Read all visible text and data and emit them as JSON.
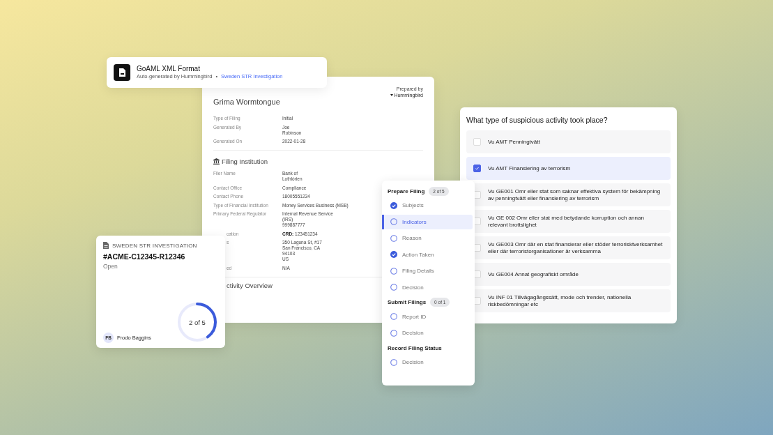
{
  "goaml_card": {
    "title": "GoAML XML Format",
    "subtitle": "Auto-generated by Hummingbird",
    "separator": "•",
    "link": "Sweden STR Investigation"
  },
  "document": {
    "prepared_by": "Prepared by",
    "brand": "Hummingbird",
    "name": "Grima Wormtongue",
    "summary": [
      {
        "label": "Type of Filing",
        "value": "Initial"
      },
      {
        "label": "Generated By",
        "value": "Joe\nRobinson"
      },
      {
        "label": "Generated On",
        "value": "2022-01-28"
      }
    ],
    "section_title": "Filing Institution",
    "fields": [
      {
        "kind": "plain",
        "label": "Filer Name",
        "value": "Bank of\nLothlórien"
      },
      {
        "kind": "plain",
        "label": "Contact Office",
        "value": "Compliance"
      },
      {
        "kind": "plain",
        "label": "Contact Phone",
        "value": "18005551234"
      },
      {
        "kind": "plain",
        "label": "Type of Financial Institution",
        "value": "Money Services Business (MSB)"
      },
      {
        "kind": "plain",
        "label": "Primary Federal Regulator",
        "value": "Internal Revenue Service\n(IRS)\n999887777"
      },
      {
        "kind": "covered",
        "label": "cation",
        "value": "**CRD:** 123451234"
      },
      {
        "kind": "covered",
        "label": "s",
        "value": "350 Laguna St, #17\nSan Francisco, CA\n94103\nUS"
      },
      {
        "kind": "covered",
        "label": "ed",
        "value": "N/A"
      }
    ],
    "next_section": "ctivity Overview"
  },
  "investigation": {
    "type": "SWEDEN STR INVESTIGATION",
    "id": "#ACME-C12345-R12346",
    "status": "Open",
    "progress": "2 of 5",
    "level": 0.4,
    "assignee_initials": "FB",
    "assignee": "Frodo Baggins"
  },
  "steps": {
    "groups": [
      {
        "title": "Prepare Filing",
        "count": "2 of 5",
        "items": [
          {
            "label": "Subjects",
            "done": true,
            "selected": false
          },
          {
            "label": "Indicators",
            "done": false,
            "selected": true
          },
          {
            "label": "Reason",
            "done": false,
            "selected": false
          },
          {
            "label": "Action Taken",
            "done": true,
            "selected": false
          },
          {
            "label": "Filing Details",
            "done": false,
            "selected": false
          },
          {
            "label": "Decision",
            "done": false,
            "selected": false
          }
        ]
      },
      {
        "title": "Submit Filings",
        "count": "0 of 1",
        "items": [
          {
            "label": "Report ID",
            "done": false,
            "selected": false
          },
          {
            "label": "Decision",
            "done": false,
            "selected": false
          }
        ]
      },
      {
        "title": "Record Filing Status",
        "items": [
          {
            "label": "Decision",
            "done": false,
            "selected": false
          }
        ]
      }
    ]
  },
  "question": {
    "title": "What type of suspicious activity took place?",
    "options": [
      {
        "label": "Vu AMT Penningtvätt",
        "checked": false
      },
      {
        "label": "Vu AMT Finansiering av terrorism",
        "checked": true
      },
      {
        "label": "Vu GE001 Omr eller stat som saknar effektiva system för bekämpning av penningtvätt eller finansiering av terrorism",
        "checked": false
      },
      {
        "label": "Vu GE 002 Omr eller stat med betydande korruption och annan relevant brottslighet",
        "checked": false
      },
      {
        "label": "Vu GE003 Omr där en stat finansierar eller stöder terrorisktverksamhet eller där terroristorganisationer är verksamma",
        "checked": false
      },
      {
        "label": "Vu GE004 Annat geografiskt område",
        "checked": false
      },
      {
        "label": "Vu INF 01 Tillvägagångssätt, mode och trender, nationella riskbedömningar etc",
        "checked": false
      }
    ]
  }
}
